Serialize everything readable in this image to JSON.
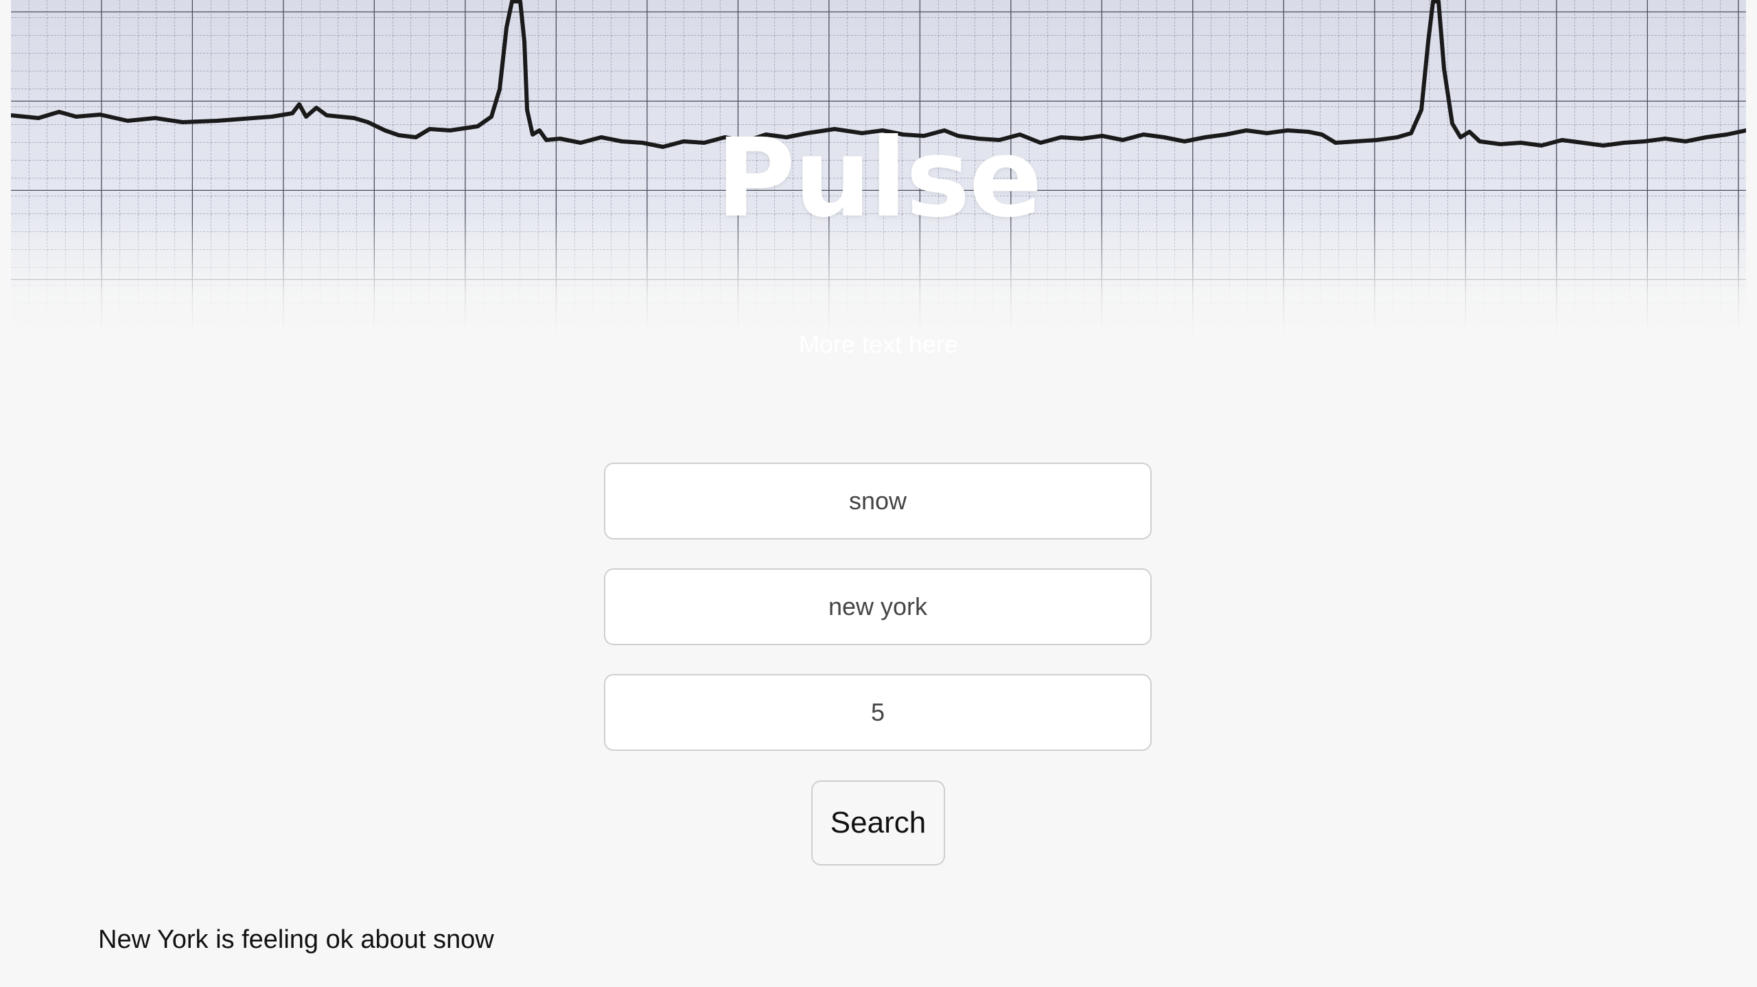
{
  "hero": {
    "title": "Pulse",
    "subtitle": "More text here",
    "image": "ecg-paper-background"
  },
  "form": {
    "term_value": "snow",
    "location_value": "new york",
    "count_value": "5",
    "search_label": "Search"
  },
  "result": {
    "text": "New York is feeling ok about snow"
  },
  "colors": {
    "page_background": "#f7f7f7",
    "title_text": "#ffffff",
    "field_border": "#cfcfcf",
    "ecg_trace": "#1a1a1a",
    "grid_major": "#4a4d5c",
    "grid_minor": "#8a8ea0"
  }
}
